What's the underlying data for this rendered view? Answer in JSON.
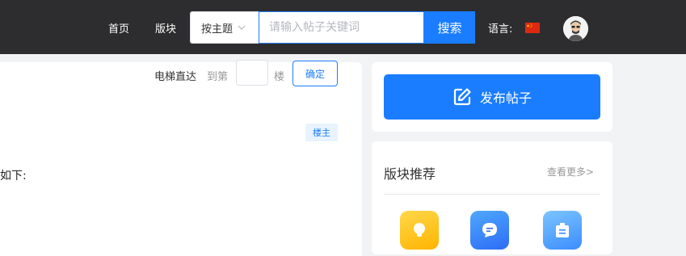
{
  "nav": {
    "home": "首页",
    "boards": "版块",
    "search_mode": "按主题",
    "search_placeholder": "请输入帖子关键词",
    "search_button": "搜索",
    "language_label": "语言:"
  },
  "post": {
    "elevator_label": "电梯直达",
    "elevator_to": "到第",
    "elevator_floor": "楼",
    "confirm_button": "确定",
    "owner_badge": "楼主",
    "content_fragment": "如下:"
  },
  "sidebar": {
    "publish_button": "发布帖子",
    "board_title": "版块推荐",
    "see_more": "查看更多>",
    "board_icons": [
      "lightbulb-icon",
      "chat-bubble-icon",
      "clipboard-icon"
    ]
  },
  "colors": {
    "accent": "#1a7dff",
    "topbar": "#2d2d2f",
    "flag": "#de2910"
  }
}
